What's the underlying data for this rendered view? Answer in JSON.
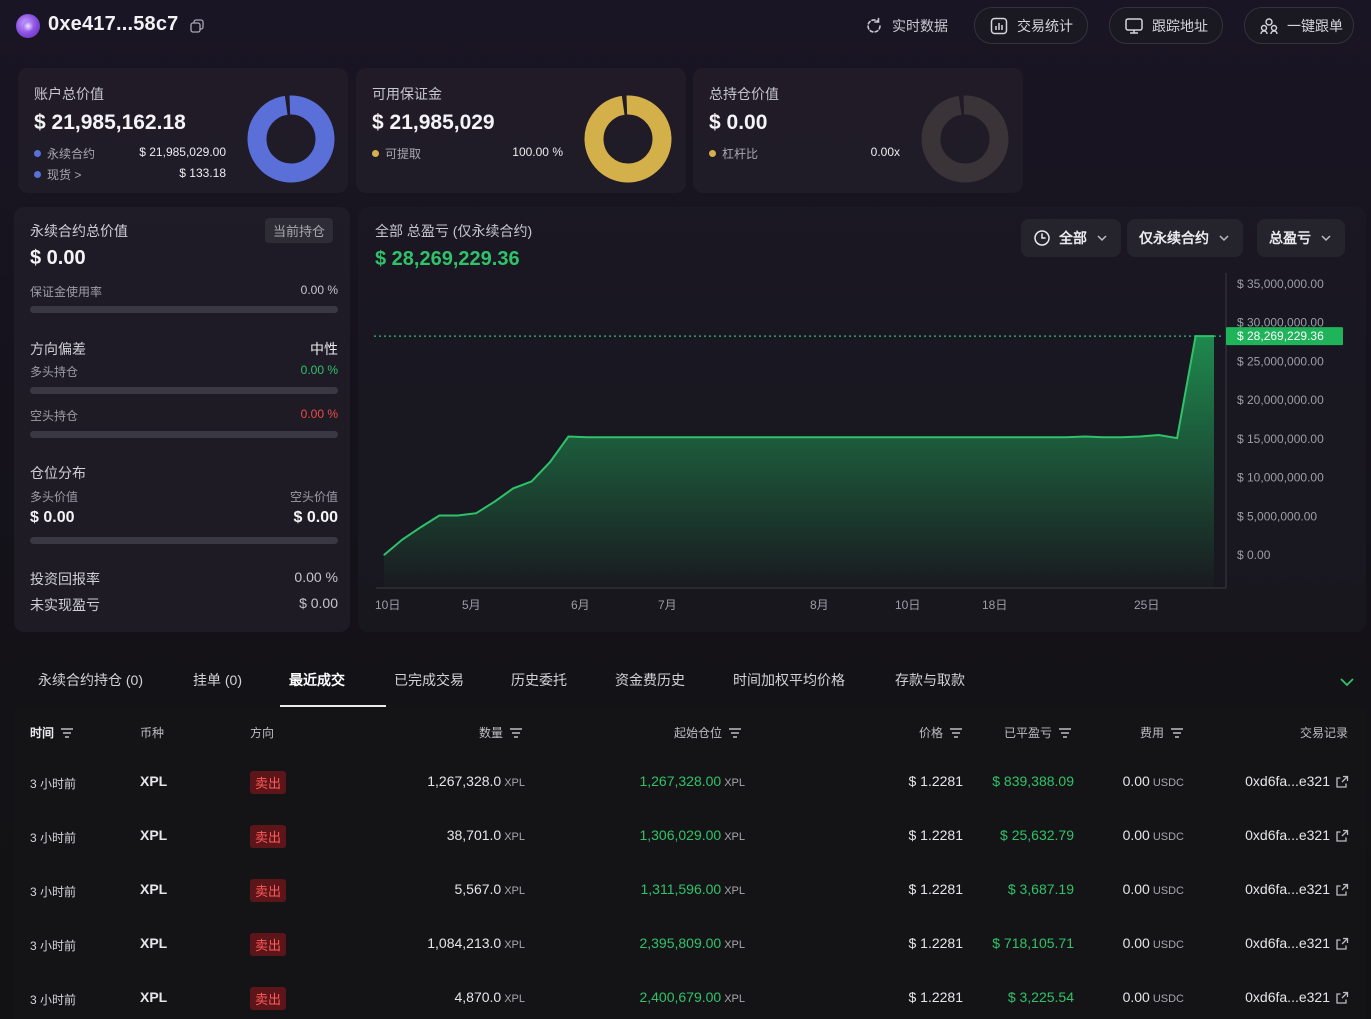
{
  "header": {
    "address": "0xe417...58c7",
    "nav": [
      {
        "label": "实时数据",
        "icon": "refresh-icon"
      },
      {
        "label": "交易统计",
        "icon": "bar-chart-icon"
      },
      {
        "label": "跟踪地址",
        "icon": "monitor-icon"
      },
      {
        "label": "一键跟单",
        "icon": "users-icon"
      }
    ]
  },
  "cards": [
    {
      "title": "账户总价值",
      "value": "$ 21,985,162.18",
      "rows": [
        {
          "label": "永续合约",
          "value": "$ 21,985,029.00",
          "color": "#5a6fd8"
        },
        {
          "label": "现货 >",
          "value": "$ 133.18",
          "color": "#5a6fd8"
        }
      ],
      "donut_color": "#5a6fd8"
    },
    {
      "title": "可用保证金",
      "value": "$ 21,985,029",
      "rows": [
        {
          "label": "可提取",
          "value": "100.00 %",
          "color": "#d4b04a"
        }
      ],
      "donut_color": "#d4b04a"
    },
    {
      "title": "总持仓价值",
      "value": "$ 0.00",
      "rows": [
        {
          "label": "杠杆比",
          "value": "0.00x",
          "color": "#d4b04a"
        }
      ],
      "donut_color": "#3a3438"
    }
  ],
  "left_panel": {
    "perp_title": "永续合约总价值",
    "perp_badge": "当前持仓",
    "perp_value": "$ 0.00",
    "margin_usage_label": "保证金使用率",
    "margin_usage_value": "0.00 %",
    "direction_label": "方向偏差",
    "direction_value": "中性",
    "long_label": "多头持仓",
    "long_value": "0.00 %",
    "short_label": "空头持仓",
    "short_value": "0.00 %",
    "dist_label": "仓位分布",
    "long_worth_label": "多头价值",
    "short_worth_label": "空头价值",
    "long_worth": "$ 0.00",
    "short_worth": "$ 0.00",
    "roi_label": "投资回报率",
    "roi_value": "0.00 %",
    "unrealized_label": "未实现盈亏",
    "unrealized_value": "$ 0.00"
  },
  "pnl_chart": {
    "title": "全部 总盈亏 (仅永续合约)",
    "total": "$ 28,269,229.36",
    "filters": [
      "全部",
      "仅永续合约",
      "总盈亏"
    ],
    "colors": {
      "line": "#2fc26a",
      "fill": "#1f9d55"
    }
  },
  "chart_data": {
    "type": "area",
    "title": "",
    "xlabel": "",
    "ylabel": "",
    "x_ticks": [
      "10日",
      "5月",
      "6月",
      "7月",
      "8月",
      "10日",
      "18日",
      "25日"
    ],
    "y_ticks": [
      "$ 0.00",
      "$ 5,000,000.00",
      "$ 10,000,000.00",
      "$ 15,000,000.00",
      "$ 20,000,000.00",
      "$ 25,000,000.00",
      "$ 30,000,000.00",
      "$ 35,000,000.00"
    ],
    "ylim": [
      0,
      35000000
    ],
    "current_label": "$ 28,269,229.36",
    "current_value": 28269229.36,
    "grid": false,
    "values": [
      0,
      2000000,
      3600000,
      5100000,
      5100000,
      5400000,
      6900000,
      8600000,
      9500000,
      12000000,
      15300000,
      15200000,
      15200000,
      15200000,
      15200000,
      15200000,
      15200000,
      15200000,
      15200000,
      15200000,
      15200000,
      15200000,
      15200000,
      15200000,
      15200000,
      15200000,
      15200000,
      15200000,
      15200000,
      15200000,
      15200000,
      15200000,
      15200000,
      15200000,
      15200000,
      15200000,
      15200000,
      15200000,
      15300000,
      15200000,
      15200000,
      15300000,
      15500000,
      15100000,
      28269229.36,
      28269229.36
    ]
  },
  "tabs": [
    {
      "label": "永续合约持仓 (0)",
      "active": false
    },
    {
      "label": "挂单 (0)",
      "active": false
    },
    {
      "label": "最近成交",
      "active": true
    },
    {
      "label": "已完成交易",
      "active": false
    },
    {
      "label": "历史委托",
      "active": false
    },
    {
      "label": "资金费历史",
      "active": false
    },
    {
      "label": "时间加权平均价格",
      "active": false
    },
    {
      "label": "存款与取款",
      "active": false
    }
  ],
  "table": {
    "headers": [
      "时间",
      "币种",
      "方向",
      "数量",
      "起始仓位",
      "价格",
      "已平盈亏",
      "费用",
      "交易记录"
    ],
    "rows": [
      {
        "time": "3 小时前",
        "coin": "XPL",
        "side": "卖出",
        "qty": "1,267,328.0",
        "qty_unit": "XPL",
        "start": "1,267,328.00",
        "start_unit": "XPL",
        "price": "$ 1.2281",
        "pnl": "$ 839,388.09",
        "fee": "0.00",
        "fee_unit": "USDC",
        "tx": "0xd6fa...e321"
      },
      {
        "time": "3 小时前",
        "coin": "XPL",
        "side": "卖出",
        "qty": "38,701.0",
        "qty_unit": "XPL",
        "start": "1,306,029.00",
        "start_unit": "XPL",
        "price": "$ 1.2281",
        "pnl": "$ 25,632.79",
        "fee": "0.00",
        "fee_unit": "USDC",
        "tx": "0xd6fa...e321"
      },
      {
        "time": "3 小时前",
        "coin": "XPL",
        "side": "卖出",
        "qty": "5,567.0",
        "qty_unit": "XPL",
        "start": "1,311,596.00",
        "start_unit": "XPL",
        "price": "$ 1.2281",
        "pnl": "$ 3,687.19",
        "fee": "0.00",
        "fee_unit": "USDC",
        "tx": "0xd6fa...e321"
      },
      {
        "time": "3 小时前",
        "coin": "XPL",
        "side": "卖出",
        "qty": "1,084,213.0",
        "qty_unit": "XPL",
        "start": "2,395,809.00",
        "start_unit": "XPL",
        "price": "$ 1.2281",
        "pnl": "$ 718,105.71",
        "fee": "0.00",
        "fee_unit": "USDC",
        "tx": "0xd6fa...e321"
      },
      {
        "time": "3 小时前",
        "coin": "XPL",
        "side": "卖出",
        "qty": "4,870.0",
        "qty_unit": "XPL",
        "start": "2,400,679.00",
        "start_unit": "XPL",
        "price": "$ 1.2281",
        "pnl": "$ 3,225.54",
        "fee": "0.00",
        "fee_unit": "USDC",
        "tx": "0xd6fa...e321"
      }
    ]
  }
}
